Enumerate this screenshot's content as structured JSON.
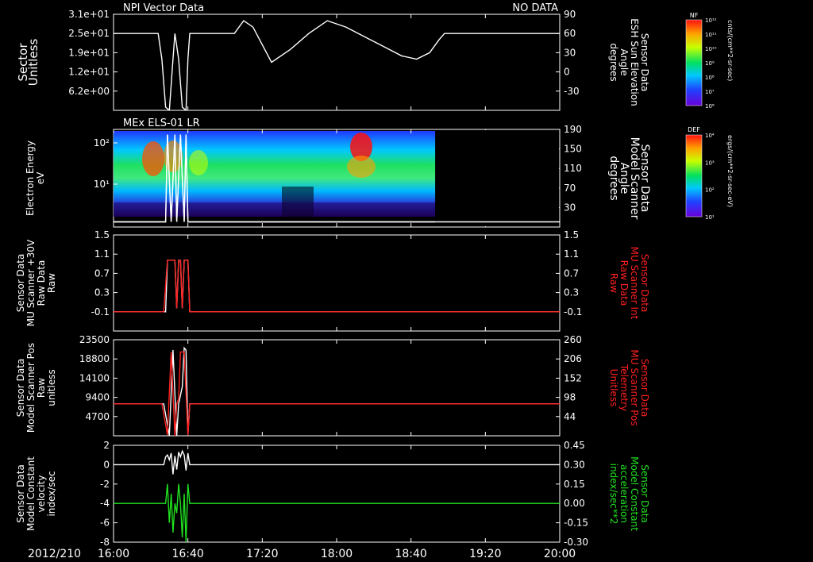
{
  "footer": {
    "date": "2012/210"
  },
  "time_axis": {
    "ticks": [
      "16:00",
      "16:40",
      "17:20",
      "18:00",
      "18:40",
      "19:20",
      "20:00"
    ]
  },
  "colors": {
    "white": "#ffffff",
    "red": "#ff2020",
    "green": "#20e020",
    "background": "#000000"
  },
  "colorbars": [
    {
      "label": "NF",
      "units": "cnts/(cm**2-sr-sec)",
      "ticks": [
        "10¹²",
        "10¹¹",
        "10¹⁰",
        "10⁹",
        "10⁸",
        "10⁷",
        "10⁶"
      ]
    },
    {
      "label": "DEF",
      "units": "ergs/(cm**2-sr-sec-eV)",
      "ticks": [
        "10⁴",
        "10³",
        "10²",
        "10¹"
      ]
    }
  ],
  "chart_data": [
    {
      "type": "line",
      "title_left": "NPI Vector Data",
      "title_right": "NO DATA",
      "ylabel_left": [
        "Sector",
        "Unitless"
      ],
      "left_ticks": [
        "3.1e+01",
        "2.5e+01",
        "1.9e+01",
        "1.2e+01",
        "6.2e+00"
      ],
      "ylabel_right": [
        "Sensor Data",
        "ESH Sun Elevation",
        "Angle",
        "degrees"
      ],
      "right_ticks": [
        "90",
        "60",
        "30",
        "0",
        "-30"
      ],
      "ylim_right": [
        -60,
        90
      ],
      "series": [
        {
          "color": "white",
          "x": [
            "16:00",
            "16:24",
            "16:26",
            "16:28",
            "16:30",
            "16:32",
            "16:33",
            "16:35",
            "16:37",
            "16:39",
            "16:40",
            "16:41",
            "16:45",
            "17:05",
            "17:10",
            "17:15",
            "17:25",
            "17:35",
            "17:45",
            "17:55",
            "18:05",
            "18:15",
            "18:25",
            "18:35",
            "18:43",
            "18:50",
            "18:55",
            "18:58",
            "20:00"
          ],
          "y": [
            60,
            60,
            20,
            -55,
            -60,
            20,
            60,
            20,
            -55,
            -60,
            20,
            60,
            60,
            60,
            80,
            70,
            15,
            35,
            60,
            80,
            70,
            55,
            40,
            25,
            20,
            30,
            50,
            60,
            60
          ]
        }
      ]
    },
    {
      "type": "heatmap",
      "title_left": "MEx ELS-01 LR",
      "ylabel_left": [
        "Electron Energy",
        "eV"
      ],
      "left_ticks": [
        "10²",
        "10¹"
      ],
      "ylabel_right": [
        "Sensor Data",
        "Model Scanner",
        "Angle",
        "degrees"
      ],
      "right_ticks": [
        "190",
        "150",
        "110",
        "70",
        "30"
      ],
      "ylim_right": [
        0,
        190
      ],
      "data_end": "18:53",
      "overlay": {
        "color": "white",
        "x": [
          "16:00",
          "16:28",
          "16:29",
          "16:31",
          "16:33",
          "16:34",
          "16:36",
          "16:38",
          "16:39",
          "16:40",
          "20:00"
        ],
        "y": [
          10,
          10,
          180,
          10,
          180,
          10,
          180,
          10,
          180,
          10,
          10
        ]
      }
    },
    {
      "type": "line",
      "ylabel_left": [
        "Sensor Data",
        "MU Scanner +30V",
        "Raw Data",
        "Raw"
      ],
      "left_ticks": [
        "1.5",
        "1.1",
        "0.7",
        "0.3",
        "-0.1"
      ],
      "ylabel_right": [
        "Sensor Data",
        "MU Scanner Int",
        "Raw Data",
        "Raw"
      ],
      "right_ticks": [
        "1.5",
        "1.1",
        "0.7",
        "0.3",
        "-0.1"
      ],
      "ylim": [
        -0.4,
        1.5
      ],
      "series": [
        {
          "color": "white",
          "x": [
            "16:00",
            "16:28",
            "16:29",
            "16:33",
            "16:34",
            "16:35",
            "16:36",
            "16:37",
            "16:38",
            "16:39",
            "16:40",
            "16:41",
            "20:00"
          ],
          "y": [
            -0.02,
            -0.02,
            1.0,
            1.0,
            0.05,
            1.0,
            1.0,
            0.05,
            1.0,
            1.0,
            1.0,
            -0.02,
            -0.02
          ]
        },
        {
          "color": "red",
          "x": [
            "16:00",
            "16:27",
            "16:29",
            "16:33",
            "16:34",
            "16:35",
            "16:36",
            "16:37",
            "16:38",
            "16:40",
            "16:41",
            "20:00"
          ],
          "y": [
            -0.02,
            -0.02,
            1.0,
            1.0,
            0.05,
            1.0,
            1.0,
            0.05,
            1.0,
            1.0,
            -0.02,
            -0.02
          ]
        }
      ]
    },
    {
      "type": "line",
      "ylabel_left": [
        "Sensor Data",
        "Model Scanner Pos",
        "Raw",
        "unitless"
      ],
      "left_ticks": [
        "23500",
        "18800",
        "14100",
        "9400",
        "4700"
      ],
      "ylabel_right": [
        "Sensor Data",
        "MU Scanner Pos",
        "Telemetry",
        "Unitless"
      ],
      "right_ticks": [
        "260",
        "206",
        "152",
        "98",
        "44"
      ],
      "ylim": [
        0,
        23500
      ],
      "series": [
        {
          "color": "white",
          "x": [
            "16:00",
            "16:27",
            "16:30",
            "16:32",
            "16:34",
            "16:35",
            "16:37",
            "16:38",
            "16:39",
            "16:40",
            "16:41",
            "20:00"
          ],
          "y": [
            7800,
            7800,
            0,
            21000,
            0,
            7800,
            12000,
            21500,
            21000,
            200,
            7800,
            7800
          ]
        },
        {
          "color": "red",
          "x": [
            "16:00",
            "16:26",
            "16:29",
            "16:31",
            "16:33",
            "16:34",
            "16:35",
            "16:36",
            "16:38",
            "16:40",
            "16:41",
            "20:00"
          ],
          "y": [
            7800,
            7800,
            200,
            20500,
            0,
            7800,
            9000,
            20500,
            20500,
            100,
            7800,
            7800
          ]
        }
      ]
    },
    {
      "type": "line",
      "ylabel_left": [
        "Sensor Data",
        "Model Constant",
        "velocity",
        "index/sec"
      ],
      "left_ticks": [
        "2",
        "0",
        "-2",
        "-4",
        "-6",
        "-8"
      ],
      "ylabel_right": [
        "Sensor Data",
        "Model Constant",
        "acceleration",
        "index/sec**2"
      ],
      "right_ticks": [
        "0.45",
        "0.30",
        "0.15",
        "0.00",
        "-0.15",
        "-0.30"
      ],
      "ylim": [
        -8,
        2
      ],
      "series": [
        {
          "color": "white",
          "x": [
            "16:00",
            "16:27",
            "16:28",
            "16:29",
            "16:30",
            "16:31",
            "16:32",
            "16:33",
            "16:34",
            "16:35",
            "16:36",
            "16:37",
            "16:38",
            "16:39",
            "16:40",
            "16:41",
            "20:00"
          ],
          "y": [
            0,
            0,
            0.8,
            1.0,
            0.5,
            1.2,
            -1.0,
            0.9,
            -0.5,
            1.3,
            0.8,
            1.4,
            1.0,
            -0.6,
            1.2,
            0,
            0
          ]
        },
        {
          "color": "green",
          "x": [
            "16:00",
            "16:28",
            "16:29",
            "16:30",
            "16:31",
            "16:32",
            "16:33",
            "16:34",
            "16:35",
            "16:36",
            "16:37",
            "16:38",
            "16:39",
            "16:40",
            "16:41",
            "20:00"
          ],
          "y": [
            -4,
            -4,
            -2,
            -6,
            -3,
            -7,
            -4,
            -5,
            -2,
            -4,
            -7.5,
            -3,
            -8,
            -2,
            -4,
            -4
          ]
        }
      ]
    }
  ]
}
